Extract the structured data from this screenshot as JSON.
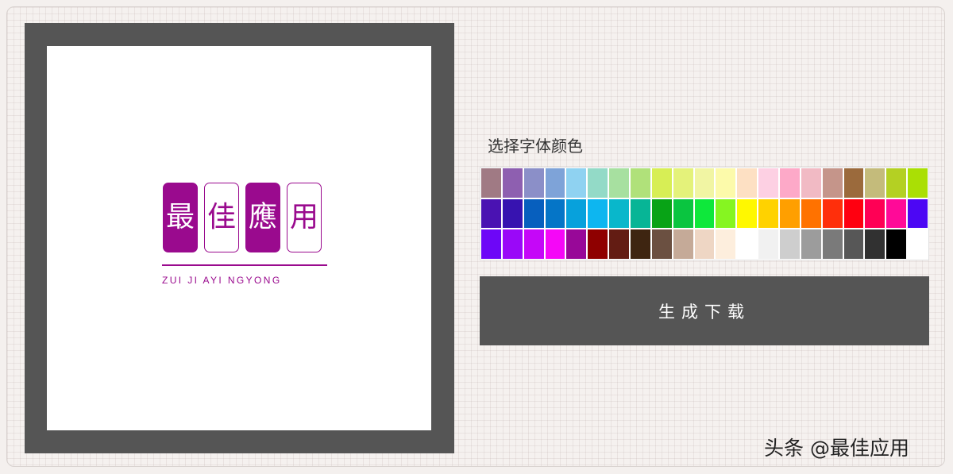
{
  "preview": {
    "logo_chars": [
      "最",
      "佳",
      "應",
      "用"
    ],
    "logo_subtitle": "ZUI JI AYI NGYONG",
    "logo_color": "#9a0a8e"
  },
  "color_picker": {
    "title": "选择字体颜色",
    "swatches": [
      "#a07a84",
      "#8e5fb0",
      "#8b8fc8",
      "#7ea3d8",
      "#8fd2f1",
      "#93dac7",
      "#a7e0a0",
      "#b0e17a",
      "#d7ee55",
      "#e4f27a",
      "#f1f5a3",
      "#fcfaaa",
      "#fde0c3",
      "#fdd0e3",
      "#fda9c8",
      "#f1bac4",
      "#c5958a",
      "#9b6a3c",
      "#c4bb7b",
      "#b4d023",
      "#aadf05",
      "#4a12b2",
      "#3713b0",
      "#075fbe",
      "#0575c7",
      "#07a1dc",
      "#0db6f0",
      "#09b7cb",
      "#07b596",
      "#08a316",
      "#0ac540",
      "#0ee83b",
      "#86f521",
      "#fff800",
      "#ffd200",
      "#ff9f00",
      "#ff7200",
      "#ff2f0b",
      "#ff0010",
      "#ff0055",
      "#ff0a98",
      "#4c07f4",
      "#6d06f7",
      "#9a08f8",
      "#c507f8",
      "#f507f7",
      "#980898",
      "#8f0000",
      "#631c13",
      "#3e2511",
      "#6b5041",
      "#c5aa98",
      "#eed6c4",
      "#fdeedd",
      "#ffffff",
      "#f1f1f1",
      "#cecece",
      "#9c9c9c",
      "#7a7a7a",
      "#575757",
      "#313131",
      "#000000"
    ]
  },
  "actions": {
    "generate_label": "生成下载"
  },
  "watermark": "头条 @最佳应用"
}
